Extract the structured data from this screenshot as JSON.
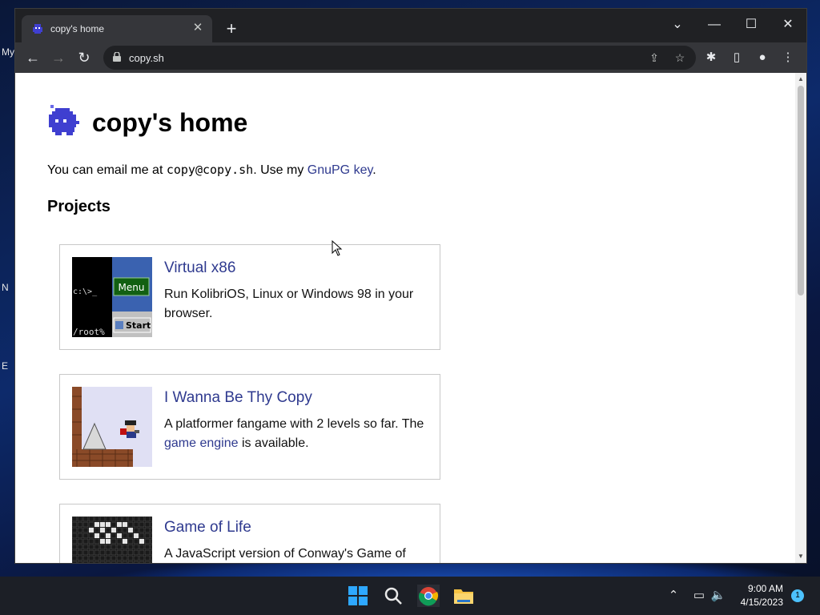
{
  "desktop": {
    "labels": [
      "My",
      "N",
      "E"
    ]
  },
  "browser": {
    "tab_title": "copy's home",
    "new_tab": "+",
    "url": "copy.sh",
    "controls": {
      "tab_search": "⌄",
      "minimize": "—",
      "maximize": "☐",
      "close": "✕"
    }
  },
  "page": {
    "title": "copy's home",
    "intro_prefix": "You can email me at ",
    "email": "copy@copy.sh",
    "intro_mid": ". Use my ",
    "gpg_link": "GnuPG key",
    "intro_suffix": ".",
    "projects_heading": "Projects",
    "projects": [
      {
        "title": "Virtual x86",
        "desc": "Run KolibriOS, Linux or Windows 98 in your browser."
      },
      {
        "title": "I Wanna Be Thy Copy",
        "desc_prefix": "A platformer fangame with 2 levels so far. The ",
        "desc_link": "game engine",
        "desc_suffix": " is available."
      },
      {
        "title": "Game of Life",
        "desc": "A JavaScript version of Conway's Game of"
      }
    ],
    "thumb_texts": {
      "prompt": "c:\\>_",
      "menu": "Menu",
      "root": "/root%",
      "start": "Start"
    }
  },
  "taskbar": {
    "time": "9:00 AM",
    "date": "4/15/2023",
    "notifications": "1"
  },
  "colors": {
    "link": "#2f3a8f",
    "logo": "#3f3fd0",
    "taskbar": "#1c1f26",
    "chrome_dark": "#202124"
  }
}
